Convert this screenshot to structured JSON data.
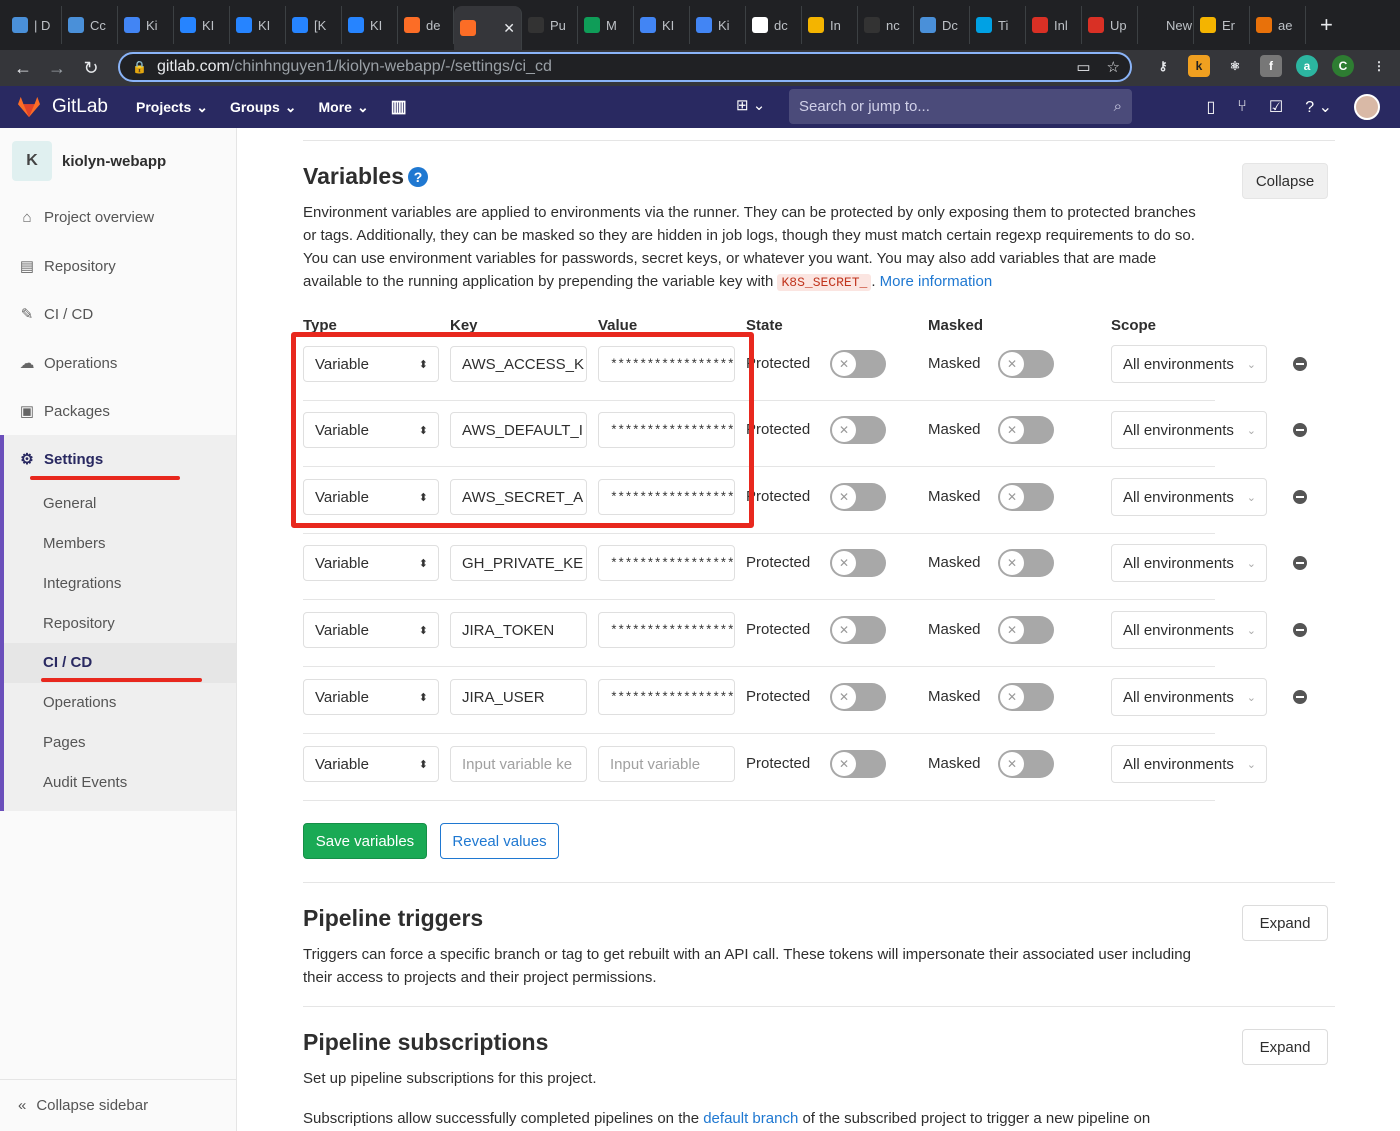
{
  "browser": {
    "tabs": [
      "| D",
      "Cc",
      "Ki",
      "KI",
      "KI",
      "[K",
      "KI",
      "de",
      "",
      "Pu",
      "M",
      "KI",
      "Ki",
      "dc",
      "In",
      "nc",
      "Dc",
      "Ti",
      "Inl",
      "Up",
      "New T",
      "Er",
      "ae"
    ],
    "url_host": "gitlab.com",
    "url_path": "/chinhnguyen1/kiolyn-webapp/-/settings/ci_cd",
    "profile_initial": "C"
  },
  "header": {
    "brand": "GitLab",
    "menus": [
      "Projects",
      "Groups",
      "More"
    ],
    "search_placeholder": "Search or jump to..."
  },
  "sidebar": {
    "project_initial": "K",
    "project_name": "kiolyn-webapp",
    "items": [
      "Project overview",
      "Repository",
      "CI / CD",
      "Operations",
      "Packages",
      "Settings"
    ],
    "sub_items": [
      "General",
      "Members",
      "Integrations",
      "Repository",
      "CI / CD",
      "Operations",
      "Pages",
      "Audit Events"
    ],
    "collapse": "Collapse sidebar"
  },
  "variables": {
    "title": "Variables",
    "collapse_label": "Collapse",
    "description_1": "Environment variables are applied to environments via the runner. They can be protected by only exposing them to protected branches or tags. Additionally, they can be masked so they are hidden in job logs, though they must match certain regexp requirements to do so. You can use environment variables for passwords, secret keys, or whatever you want. You may also add variables that are made available to the running application by prepending the variable key with",
    "code": "K8S_SECRET_",
    "more_info": "More information",
    "columns": [
      "Type",
      "Key",
      "Value",
      "State",
      "Masked",
      "Scope"
    ],
    "rows": [
      {
        "type": "Variable",
        "key": "AWS_ACCESS_K",
        "value": "*****************",
        "state": "Protected",
        "masked": "Masked",
        "scope": "All environments"
      },
      {
        "type": "Variable",
        "key": "AWS_DEFAULT_I",
        "value": "*****************",
        "state": "Protected",
        "masked": "Masked",
        "scope": "All environments"
      },
      {
        "type": "Variable",
        "key": "AWS_SECRET_A",
        "value": "*****************",
        "state": "Protected",
        "masked": "Masked",
        "scope": "All environments"
      },
      {
        "type": "Variable",
        "key": "GH_PRIVATE_KE",
        "value": "*****************",
        "state": "Protected",
        "masked": "Masked",
        "scope": "All environments"
      },
      {
        "type": "Variable",
        "key": "JIRA_TOKEN",
        "value": "*****************",
        "state": "Protected",
        "masked": "Masked",
        "scope": "All environments"
      },
      {
        "type": "Variable",
        "key": "JIRA_USER",
        "value": "*****************",
        "state": "Protected",
        "masked": "Masked",
        "scope": "All environments"
      }
    ],
    "new_row": {
      "type": "Variable",
      "key_placeholder": "Input variable ke",
      "value_placeholder": "Input variable",
      "state": "Protected",
      "masked": "Masked",
      "scope": "All environments"
    },
    "save_label": "Save variables",
    "reveal_label": "Reveal values"
  },
  "triggers": {
    "title": "Pipeline triggers",
    "expand_label": "Expand",
    "description": "Triggers can force a specific branch or tag to get rebuilt with an API call. These tokens will impersonate their associated user including their access to projects and their project permissions."
  },
  "subscriptions": {
    "title": "Pipeline subscriptions",
    "expand_label": "Expand",
    "description": "Set up pipeline subscriptions for this project.",
    "description_2a": "Subscriptions allow successfully completed pipelines on the",
    "link": "default branch",
    "description_2b": "of the subscribed project to trigger a new pipeline on"
  },
  "colors": {
    "header": "#292961",
    "save": "#1aaa55",
    "link": "#1f78d1",
    "annotation": "#e8281e"
  }
}
